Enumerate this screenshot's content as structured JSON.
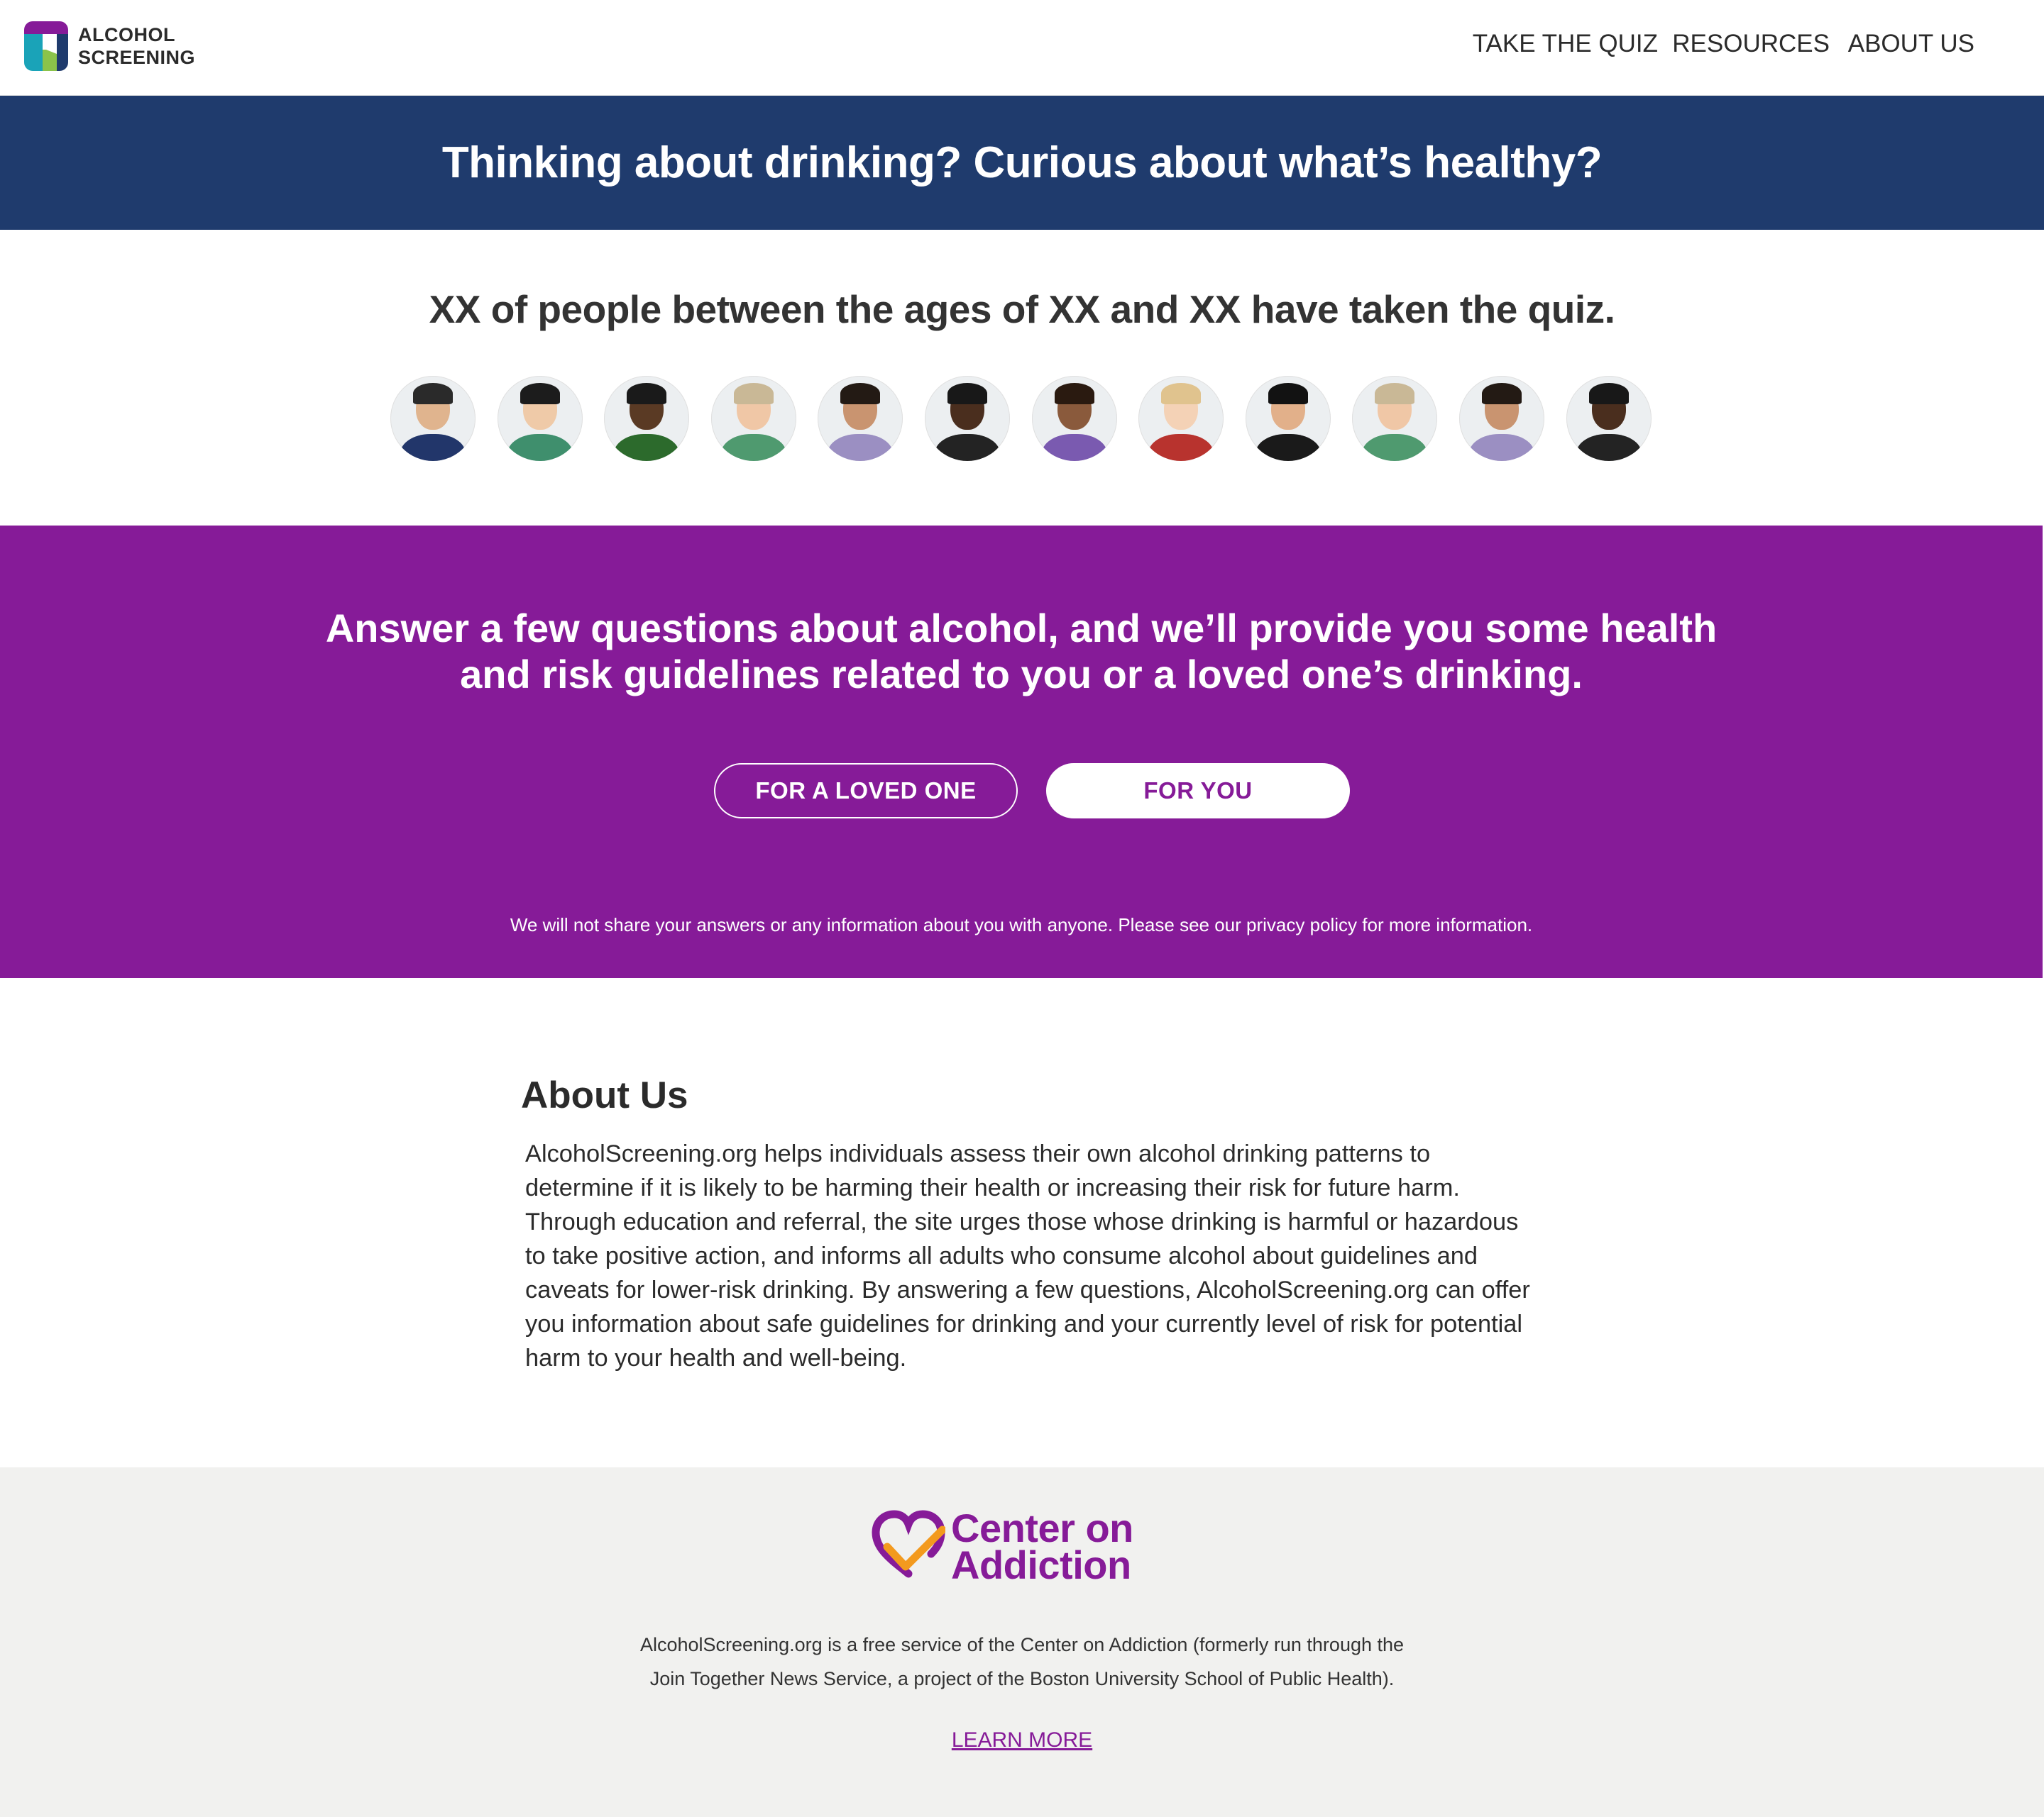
{
  "header": {
    "logo_line1": "ALCOHOL",
    "logo_line2": "SCREENING",
    "nav": [
      "TAKE THE QUIZ",
      "RESOURCES",
      "ABOUT US"
    ]
  },
  "banner": {
    "title": "Thinking about drinking? Curious about what’s healthy?"
  },
  "stats": {
    "title": "XX of people between the ages of XX and XX have taken the quiz."
  },
  "quiz": {
    "text_line1": "Answer a few questions about alcohol, and we’ll provide you some health",
    "text_line2": "and risk guidelines related to you or a loved one’s drinking.",
    "button_loved_one": "FOR A LOVED ONE",
    "button_you": "FOR YOU",
    "privacy": "We will not share your answers or any information about you with anyone. Please see our privacy policy for more information."
  },
  "about": {
    "title": "About Us",
    "body": "AlcoholScreening.org helps individuals assess their own alcohol drinking patterns to determine if it is likely to be harming their health or increasing their risk for future harm. Through education and referral, the site urges those whose drinking is harmful or hazardous to take positive action, and informs all adults who consume alcohol about guidelines and caveats for lower-risk drinking. By answering a few questions, AlcoholScreening.org can offer you information about safe guidelines for drinking and your currently level of risk for potential harm to your health and well-being."
  },
  "footer": {
    "logo_line1": "Center on",
    "logo_line2": "Addiction",
    "text_line1": "AlcoholScreening.org is a free service of the Center on Addiction (formerly run through the",
    "text_line2": "Join Together News Service, a project of the Boston University School of Public Health).",
    "learn_more": "LEARN MORE"
  },
  "colors": {
    "navy": "#1f3b6d",
    "purple": "#861b98",
    "footer_bg": "#f1f1ef",
    "orange": "#f39a1e"
  }
}
